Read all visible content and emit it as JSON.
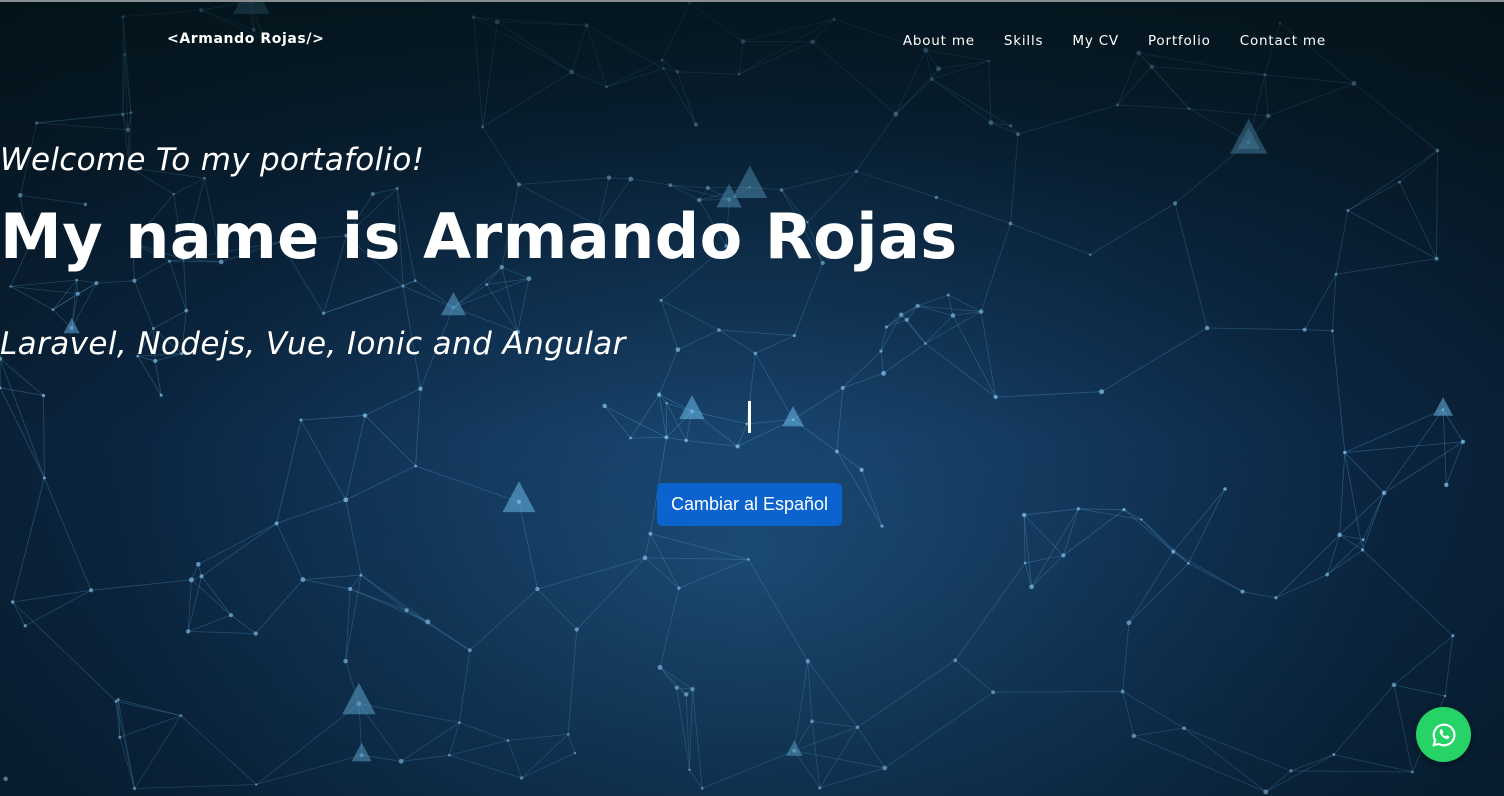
{
  "header": {
    "brand": "<Armando Rojas/>",
    "nav": [
      {
        "label": "About me"
      },
      {
        "label": "Skills"
      },
      {
        "label": "My CV"
      },
      {
        "label": "Portfolio"
      },
      {
        "label": "Contact me"
      }
    ]
  },
  "hero": {
    "welcome": "Welcome To my portafolio!",
    "name": "My name is Armando Rojas",
    "technologies": "Laravel, Nodejs, Vue, Ionic and Angular",
    "language_button": "Cambiar al Español"
  },
  "floating": {
    "whatsapp_icon": "whatsapp-icon"
  },
  "colors": {
    "button_blue": "#0b63ce",
    "whatsapp_green": "#25d366"
  }
}
